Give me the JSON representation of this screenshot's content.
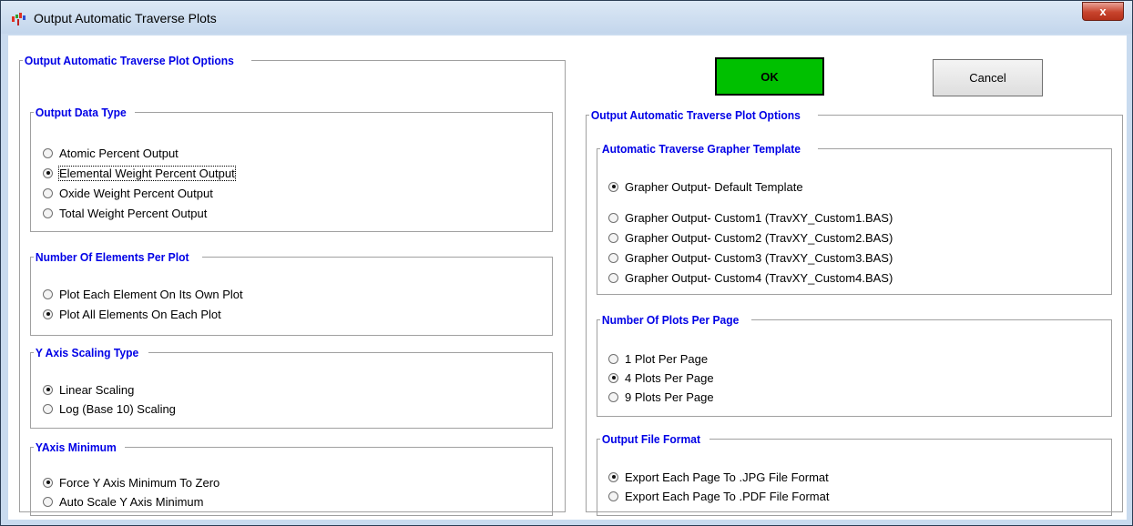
{
  "window": {
    "title": "Output Automatic Traverse Plots",
    "close_label": "x"
  },
  "buttons": {
    "ok": "OK",
    "cancel": "Cancel"
  },
  "left_panel": {
    "title": "Output Automatic Traverse Plot Options",
    "output_data_type": {
      "title": "Output Data Type",
      "options": [
        "Atomic Percent Output",
        "Elemental Weight Percent Output",
        "Oxide Weight Percent Output",
        "Total Weight Percent Output"
      ],
      "selected": 1
    },
    "elements_per_plot": {
      "title": "Number Of Elements Per Plot",
      "options": [
        "Plot Each Element On Its Own Plot",
        "Plot All Elements On Each Plot"
      ],
      "selected": 1
    },
    "y_axis_scaling": {
      "title": "Y Axis Scaling Type",
      "options": [
        "Linear Scaling",
        "Log (Base 10) Scaling"
      ],
      "selected": 0
    },
    "y_axis_minimum": {
      "title": "YAxis Minimum",
      "options": [
        "Force Y Axis Minimum To Zero",
        "Auto Scale Y Axis Minimum"
      ],
      "selected": 0
    }
  },
  "right_panel": {
    "title": "Output Automatic Traverse Plot Options",
    "grapher_template": {
      "title": "Automatic Traverse Grapher Template",
      "options": [
        "Grapher Output- Default Template",
        "Grapher Output- Custom1 (TravXY_Custom1.BAS)",
        "Grapher Output- Custom2 (TravXY_Custom2.BAS)",
        "Grapher Output- Custom3 (TravXY_Custom3.BAS)",
        "Grapher Output- Custom4 (TravXY_Custom4.BAS)"
      ],
      "selected": 0
    },
    "plots_per_page": {
      "title": "Number Of Plots Per Page",
      "options": [
        "1 Plot Per Page",
        "4 Plots Per Page",
        "9 Plots Per Page"
      ],
      "selected": 1
    },
    "output_file_format": {
      "title": "Output File Format",
      "options": [
        "Export Each Page To .JPG File Format",
        "Export Each Page To .PDF File Format"
      ],
      "selected": 0
    }
  },
  "colors": {
    "ok_button": "#00c000",
    "group_title": "#0000e6"
  }
}
